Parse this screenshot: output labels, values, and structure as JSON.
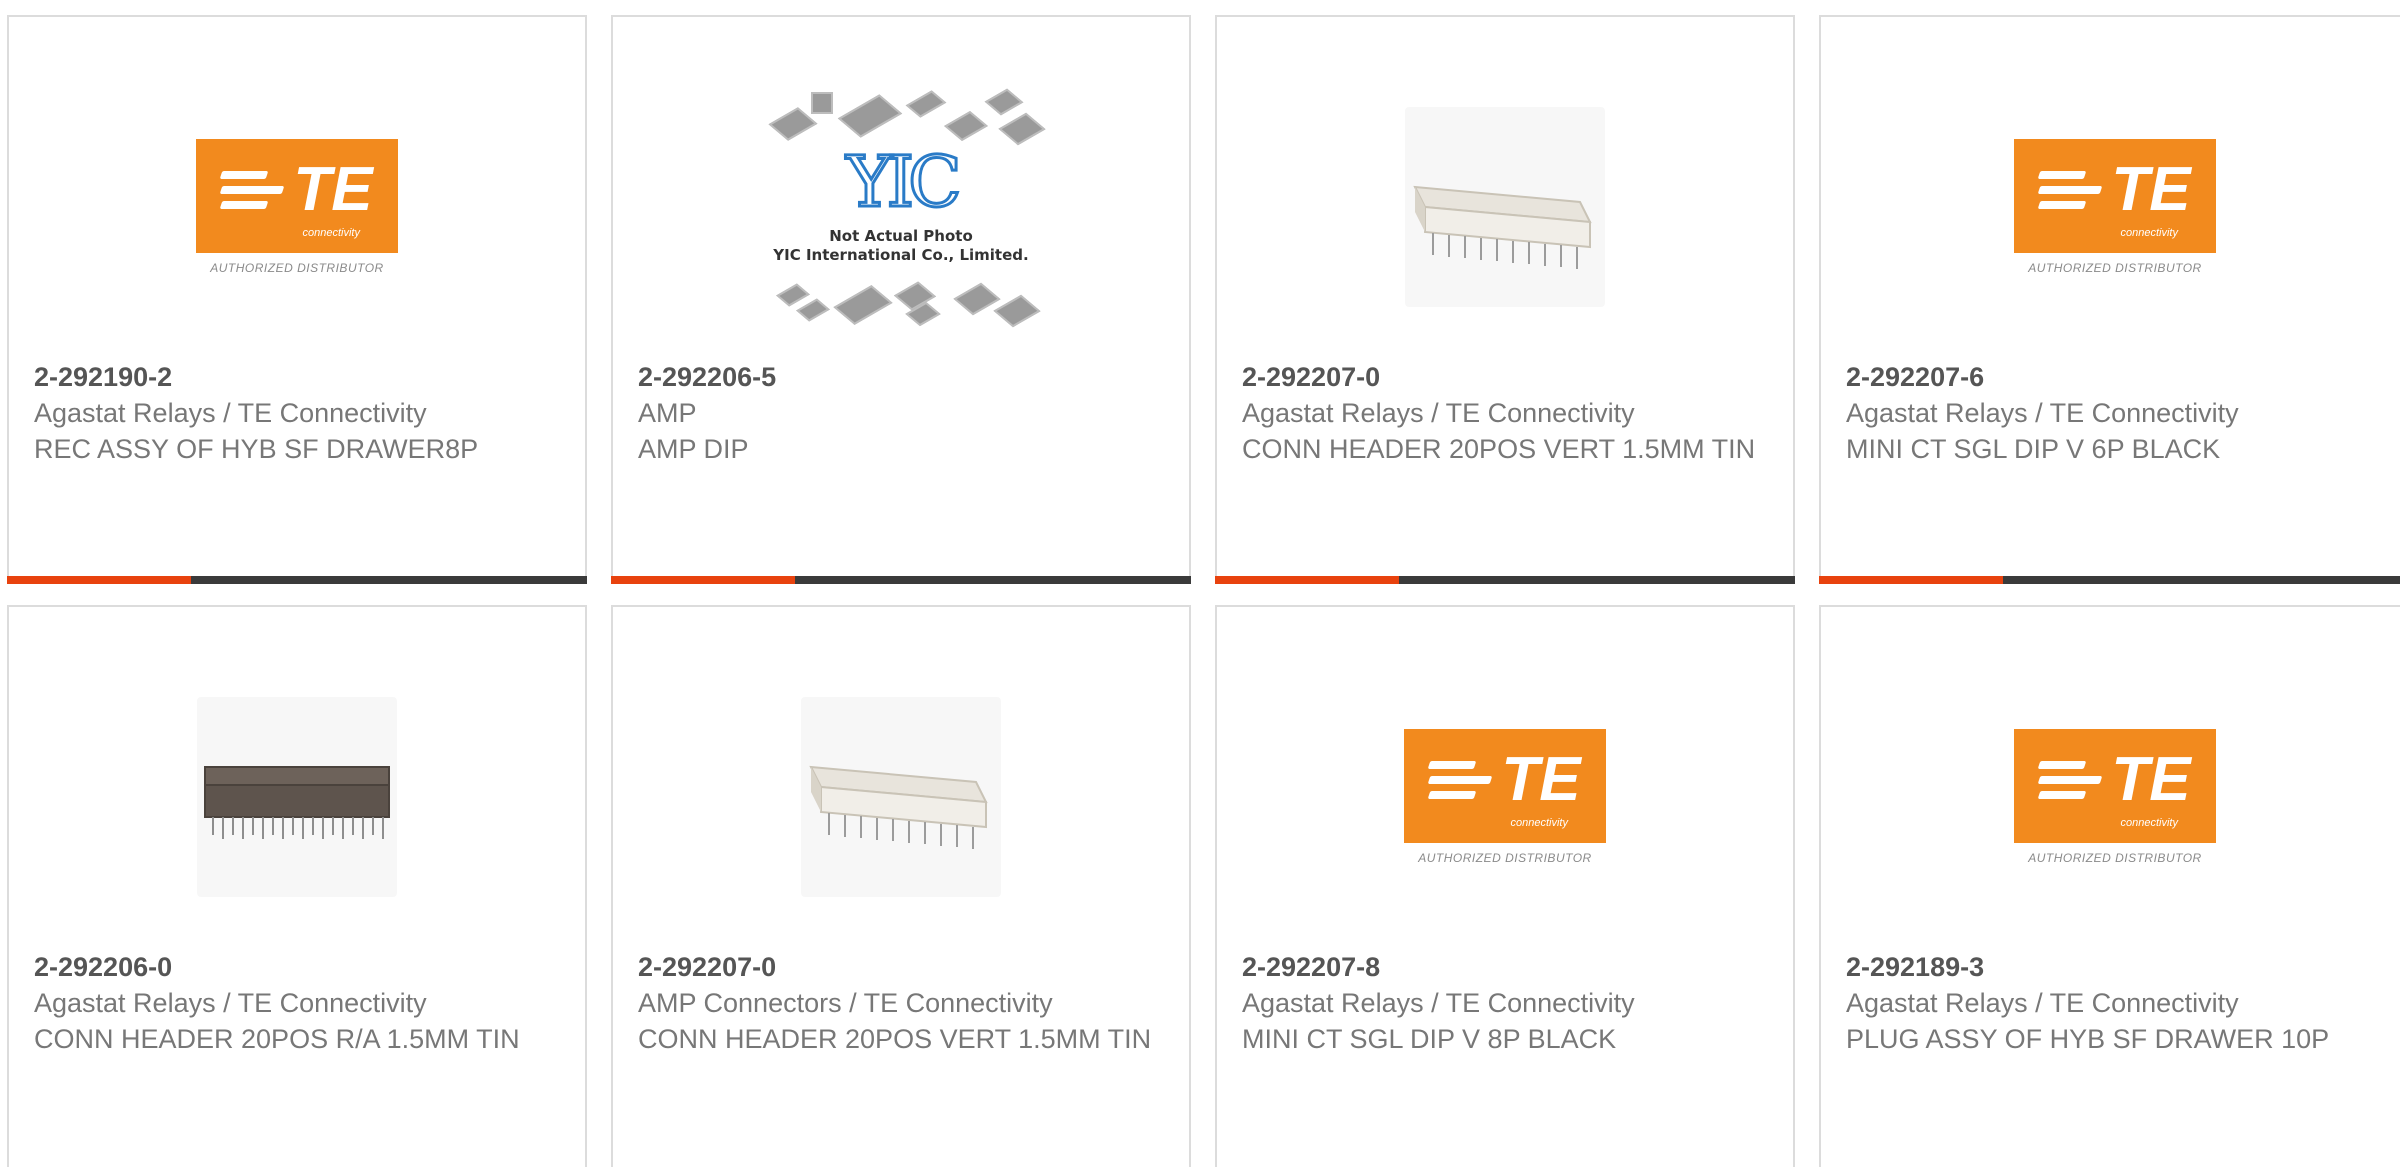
{
  "colors": {
    "accent": "#e8420e",
    "bar": "#3a3a3a",
    "te_orange": "#f28a1e"
  },
  "te_logo": {
    "letters": "TE",
    "sub": "connectivity",
    "authorized": "AUTHORIZED DISTRIBUTOR"
  },
  "yic_placeholder": {
    "logo": "YIC",
    "line1": "Not Actual Photo",
    "line2": "YIC International Co., Limited."
  },
  "products": [
    {
      "part_number": "2-292190-2",
      "manufacturer": "Agastat Relays / TE Connectivity",
      "description": "REC ASSY OF HYB SF DRAWER8P",
      "image": "te-logo"
    },
    {
      "part_number": "2-292206-5",
      "manufacturer": "AMP",
      "description": "AMP DIP",
      "image": "yic-placeholder"
    },
    {
      "part_number": "2-292207-0",
      "manufacturer": "Agastat Relays / TE Connectivity",
      "description": "CONN HEADER 20POS VERT 1.5MM TIN",
      "image": "header-vertical-white"
    },
    {
      "part_number": "2-292207-6",
      "manufacturer": "Agastat Relays / TE Connectivity",
      "description": "MINI CT SGL DIP V 6P BLACK",
      "image": "te-logo"
    },
    {
      "part_number": "2-292206-0",
      "manufacturer": "Agastat Relays / TE Connectivity",
      "description": "CONN HEADER 20POS R/A 1.5MM TIN",
      "image": "header-right-angle-dark"
    },
    {
      "part_number": "2-292207-0",
      "manufacturer": "AMP Connectors / TE Connectivity",
      "description": "CONN HEADER 20POS VERT 1.5MM TIN",
      "image": "header-vertical-white"
    },
    {
      "part_number": "2-292207-8",
      "manufacturer": "Agastat Relays / TE Connectivity",
      "description": "MINI CT SGL DIP V 8P BLACK",
      "image": "te-logo"
    },
    {
      "part_number": "2-292189-3",
      "manufacturer": "Agastat Relays / TE Connectivity",
      "description": "PLUG ASSY OF HYB SF DRAWER 10P",
      "image": "te-logo"
    }
  ]
}
